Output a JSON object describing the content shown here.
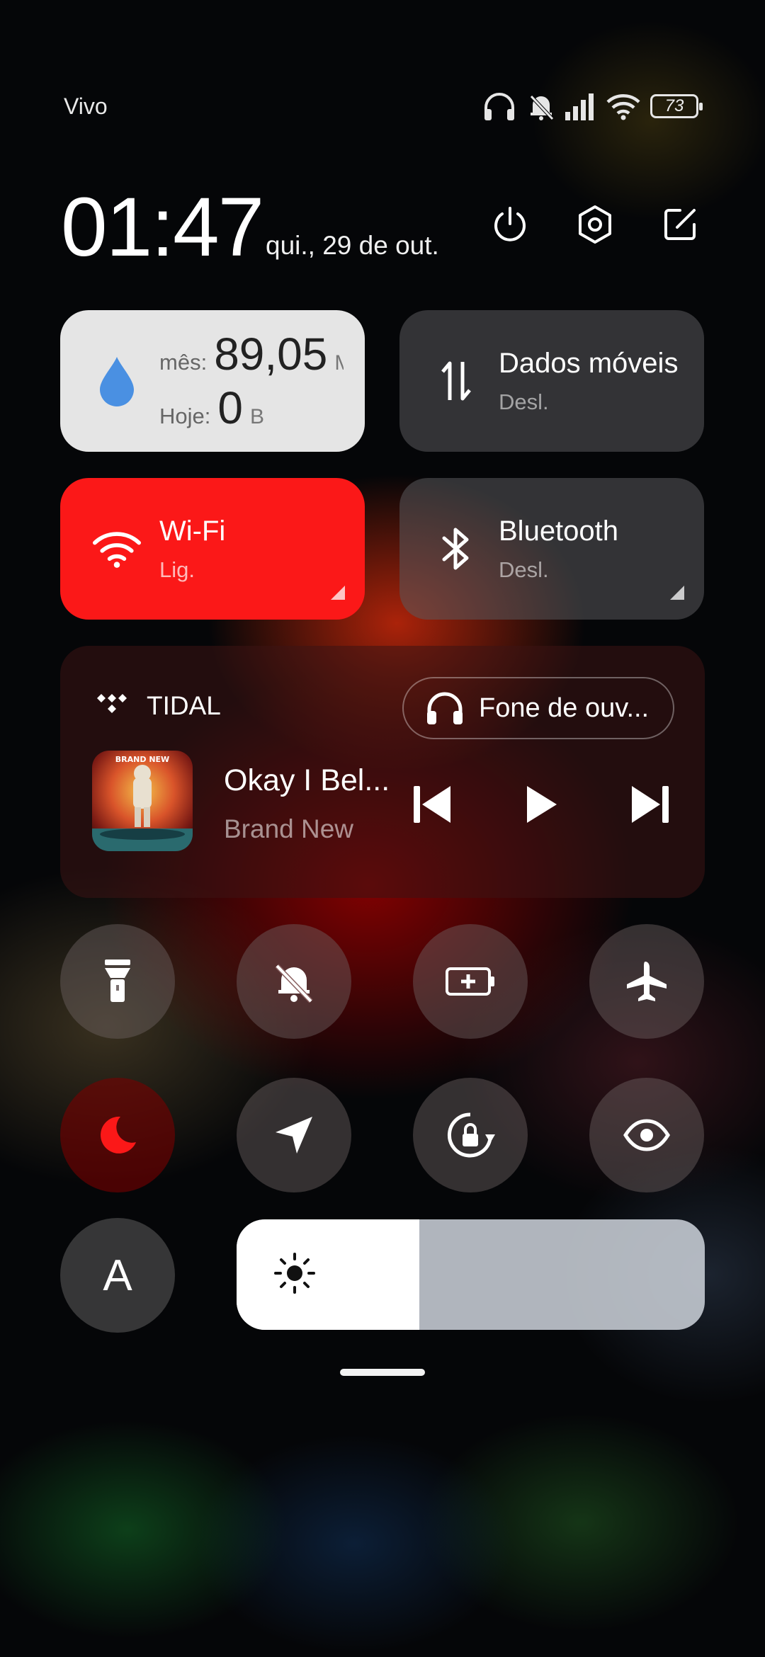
{
  "status_bar": {
    "carrier": "Vivo",
    "battery_level": "73",
    "icons": [
      "headphones-icon",
      "mute-bell-icon",
      "signal-icon",
      "wifi-icon",
      "battery-icon"
    ]
  },
  "header": {
    "time": "01:47",
    "date": "qui., 29 de out.",
    "buttons": [
      "power-icon",
      "settings-icon",
      "edit-icon"
    ]
  },
  "tiles": {
    "data_usage": {
      "month_label": "mês:",
      "month_value": "89,05",
      "month_unit": "M",
      "today_label": "Hoje:",
      "today_value": "0",
      "today_unit": "B",
      "icon": "water-drop-icon",
      "accent": "#4a90e2"
    },
    "mobile_data": {
      "title": "Dados móveis",
      "status": "Desl.",
      "icon": "data-arrows-icon"
    },
    "wifi": {
      "title": "Wi-Fi",
      "status": "Lig.",
      "icon": "wifi-icon",
      "color": "#fb1818"
    },
    "bluetooth": {
      "title": "Bluetooth",
      "status": "Desl.",
      "icon": "bluetooth-icon"
    }
  },
  "media": {
    "app": "TIDAL",
    "output": "Fone de ouv...",
    "track": "Okay I Bel...",
    "artist": "Brand New",
    "album_art_text": "BRAND NEW",
    "controls": [
      "previous-icon",
      "play-icon",
      "next-icon"
    ]
  },
  "toggles": [
    {
      "name": "flashlight",
      "icon": "flashlight-icon",
      "active": false
    },
    {
      "name": "mute",
      "icon": "mute-bell-icon",
      "active": false
    },
    {
      "name": "battery-saver",
      "icon": "battery-saver-icon",
      "active": false
    },
    {
      "name": "airplane",
      "icon": "airplane-icon",
      "active": false
    },
    {
      "name": "dark-mode",
      "icon": "moon-icon",
      "active": true
    },
    {
      "name": "location",
      "icon": "location-arrow-icon",
      "active": false
    },
    {
      "name": "rotation-lock",
      "icon": "rotation-lock-icon",
      "active": false
    },
    {
      "name": "reading-mode",
      "icon": "eye-icon",
      "active": false
    }
  ],
  "auto_brightness_label": "A",
  "brightness_level": 0.39,
  "accent_red": "#fb1818"
}
